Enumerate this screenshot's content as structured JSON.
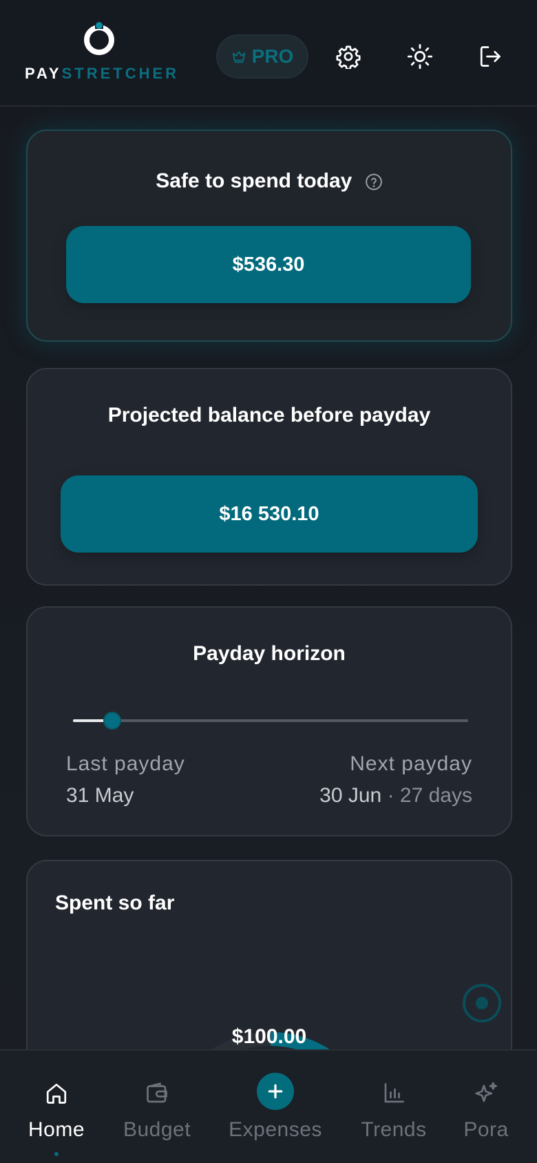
{
  "header": {
    "logo_text_part1": "PAY",
    "logo_text_part2": "STRETCHER",
    "pro_label": "PRO"
  },
  "safe_card": {
    "title": "Safe to spend today",
    "amount": "$536.30"
  },
  "projected_card": {
    "title": "Projected balance before payday",
    "amount": "$16 530.10"
  },
  "horizon_card": {
    "title": "Payday horizon",
    "progress": 0.1,
    "last_label": "Last payday",
    "last_date": "31 May",
    "next_label": "Next payday",
    "next_date": "30 Jun",
    "separator": " · ",
    "next_days": "27 days"
  },
  "spent_card": {
    "title": "Spent so far",
    "amount": "$100.00",
    "progress": 0.21
  },
  "nav": {
    "items": [
      {
        "label": "Home",
        "icon": "home-icon",
        "active": true
      },
      {
        "label": "Budget",
        "icon": "wallet-icon",
        "active": false
      },
      {
        "label": "Expenses",
        "icon": "plus-icon",
        "active": false
      },
      {
        "label": "Trends",
        "icon": "bar-chart-icon",
        "active": false
      },
      {
        "label": "Pora",
        "icon": "sparkle-icon",
        "active": false
      }
    ]
  },
  "colors": {
    "accent": "#026a7c",
    "background": "#181c22",
    "card": "#22262e"
  }
}
